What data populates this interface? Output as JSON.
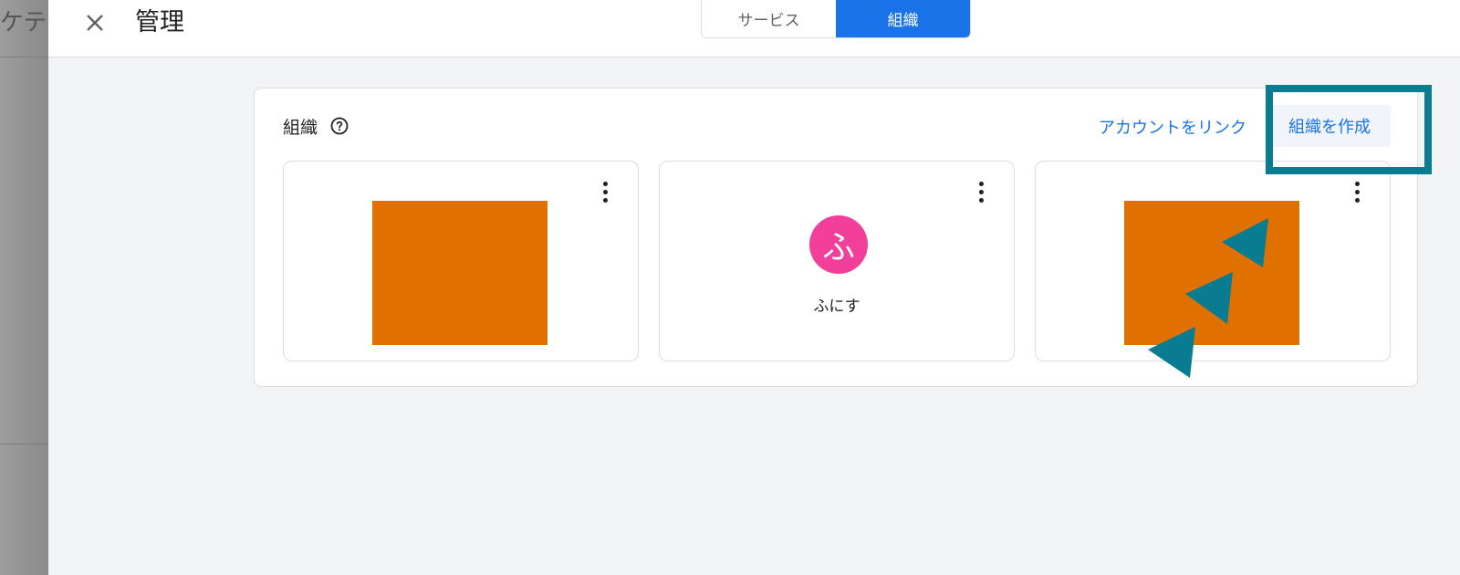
{
  "backdrop": {
    "partial_text": "ケテ"
  },
  "header": {
    "title": "管理",
    "close_icon": "close-icon"
  },
  "segmented": {
    "items": [
      {
        "label": "サービス",
        "state": "inactive"
      },
      {
        "label": "組織",
        "state": "active"
      }
    ]
  },
  "orgs_section": {
    "title": "組織",
    "help_icon": "help-circle-icon",
    "link_account_label": "アカウントをリンク",
    "create_label": "組織を作成",
    "tiles": [
      {
        "type": "logo",
        "logo_color": "#e07000",
        "more_icon": "more-vert-icon"
      },
      {
        "type": "avatar",
        "avatar_letter": "ふ",
        "avatar_color": "#f23f9a",
        "name": "ふにす",
        "more_icon": "more-vert-icon"
      },
      {
        "type": "logo",
        "logo_color": "#e07000",
        "more_icon": "more-vert-icon"
      }
    ]
  },
  "annotation": {
    "highlight_color": "#0a7c91",
    "arrow_color": "#0a7c91"
  }
}
